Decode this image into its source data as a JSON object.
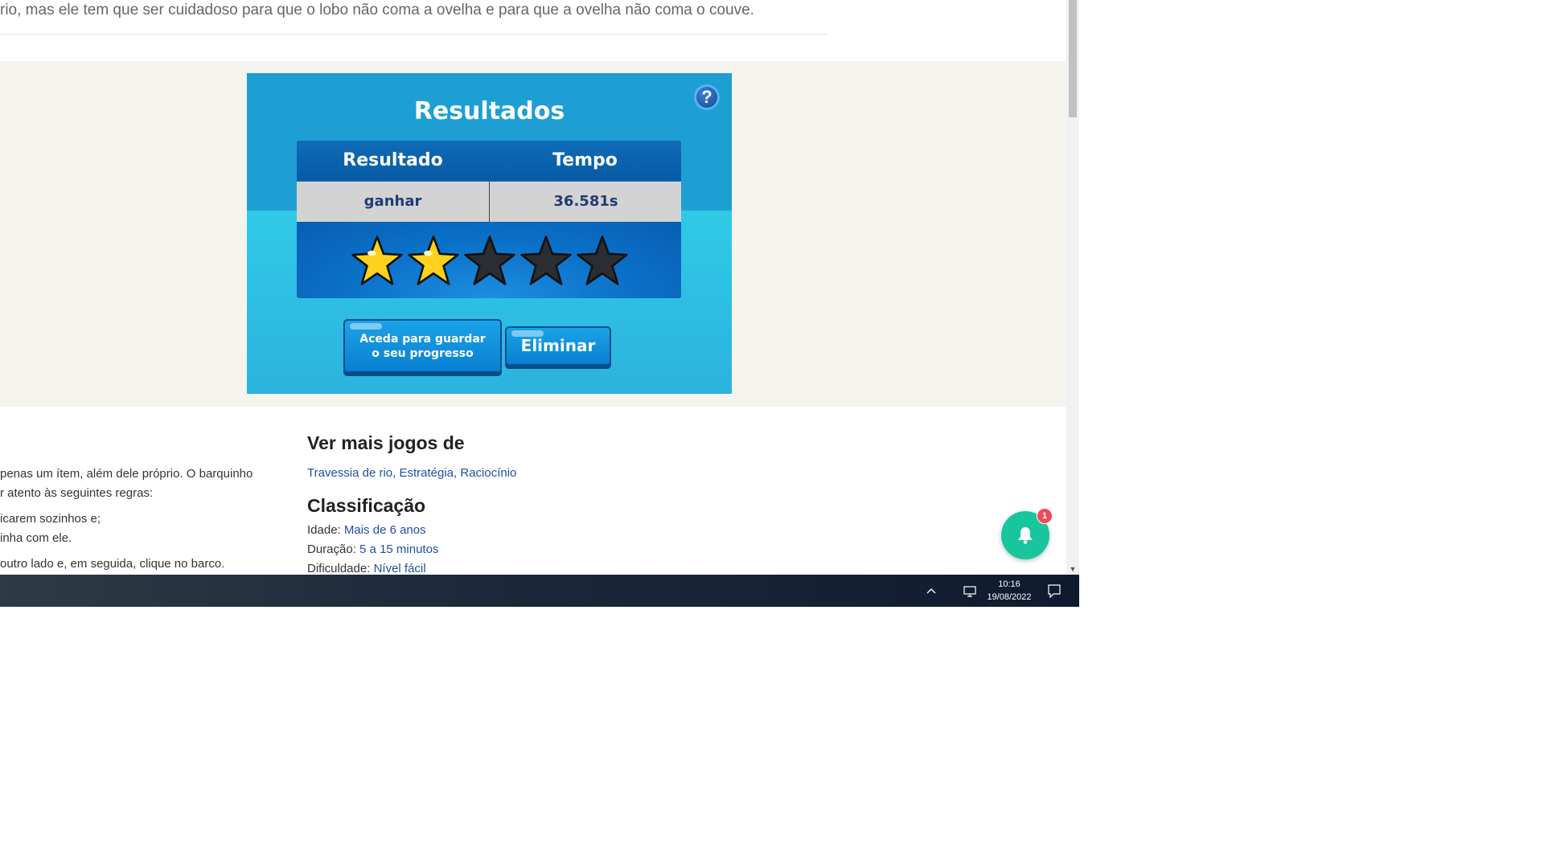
{
  "page": {
    "intro_text": "rio, mas ele tem que ser cuidadoso para que o lobo não coma a ovelha e para que a ovelha não coma o couve."
  },
  "game": {
    "title": "Resultados",
    "help_label": "?",
    "columns": [
      "Resultado",
      "Tempo"
    ],
    "result": "ganhar",
    "time": "36.581s",
    "rating": {
      "stars_filled": 2,
      "stars_total": 5
    },
    "save_button": {
      "line1": "Aceda para guardar",
      "line2": "o seu progresso"
    },
    "delete_button": "Eliminar",
    "colors": {
      "frame_top": "#1e9fd3",
      "frame_bottom": "#2bb3de",
      "panel": "#0b72c9",
      "star_on": "#ffd21f",
      "star_off": "#2a2e33"
    }
  },
  "instructions": {
    "lines": [
      "penas um ítem, além dele próprio. O barquinho",
      "r atento às seguintes regras:",
      "icarem sozinhos e;",
      "inha com ele.",
      "outro lado e, em seguida, clique no barco."
    ]
  },
  "sidebar": {
    "more_games_heading": "Ver mais jogos de",
    "tags": "Travessia de rio, Estratégia, Raciocínio",
    "classification_heading": "Classificação",
    "age_label": "Idade:",
    "age_value": "Mais de 6 anos",
    "duration_label": "Duração:",
    "duration_value": "5 a 15 minutos",
    "difficulty_label": "Dificuldade:",
    "difficulty_value": "Nível fácil"
  },
  "notification": {
    "badge": "1",
    "color": "#17c69c"
  },
  "taskbar": {
    "time": "10:16",
    "date": "19/08/2022"
  }
}
